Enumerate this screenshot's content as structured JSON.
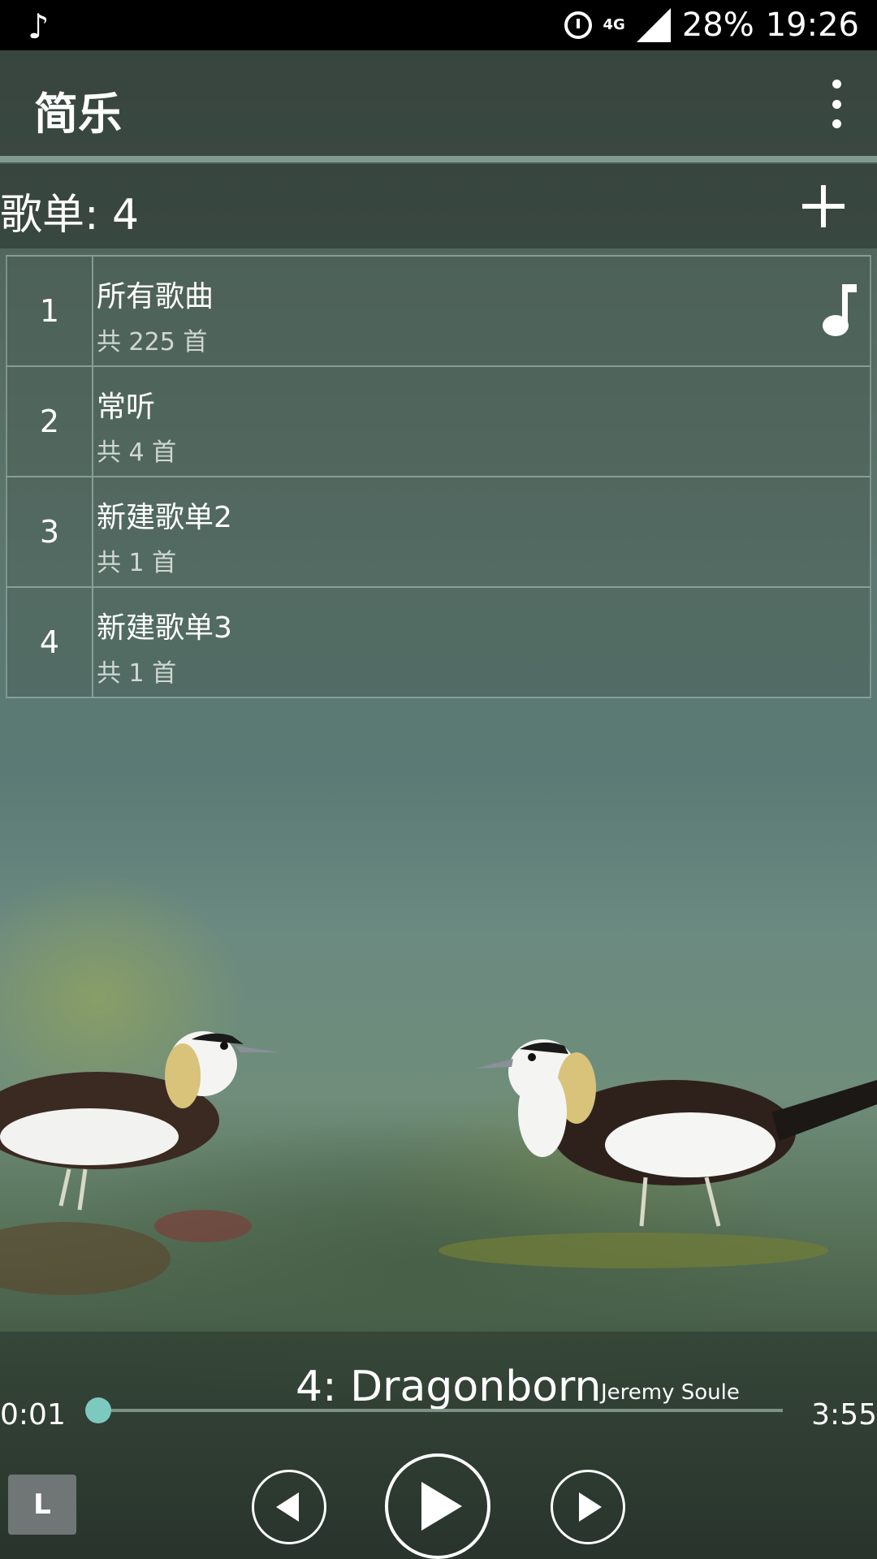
{
  "status_bar": {
    "left_icon": "music-note-icon",
    "alarm_icon": "alarm-icon",
    "network": "4G",
    "battery": "28%",
    "time": "19:26"
  },
  "app_bar": {
    "title": "简乐",
    "overflow_icon": "more-vertical-icon"
  },
  "playlists_header": {
    "label": "歌单: 4",
    "add_icon": "add-icon"
  },
  "playlists": [
    {
      "index": "1",
      "name": "所有歌曲",
      "count": "共 225 首",
      "playing": true
    },
    {
      "index": "2",
      "name": "常听",
      "count": "共 4 首",
      "playing": false
    },
    {
      "index": "3",
      "name": "新建歌单2",
      "count": "共 1 首",
      "playing": false
    },
    {
      "index": "4",
      "name": "新建歌单3",
      "count": "共 1 首",
      "playing": false
    }
  ],
  "player": {
    "title": "4: Dragonborn",
    "artist": "Jeremy Soule",
    "current_time": "0:01",
    "total_time": "3:55",
    "progress": 0.004,
    "loop_label": "L",
    "accent_color": "#7cc9c0"
  }
}
